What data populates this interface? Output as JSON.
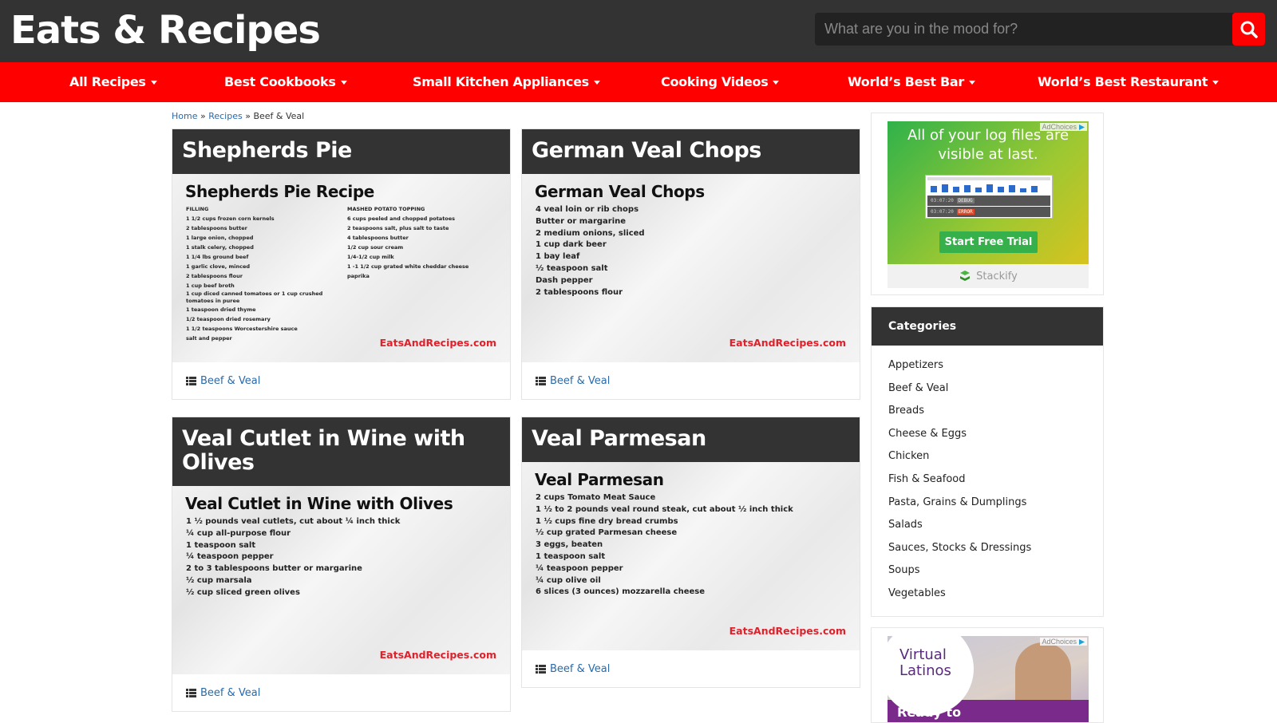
{
  "header": {
    "logo": "Eats & Recipes",
    "search_placeholder": "What are you in the mood for?"
  },
  "nav": {
    "items": [
      {
        "label": "All Recipes"
      },
      {
        "label": "Best Cookbooks"
      },
      {
        "label": "Small Kitchen Appliances"
      },
      {
        "label": "Cooking Videos"
      },
      {
        "label": "World’s Best Bar"
      },
      {
        "label": "World’s Best Restaurant"
      }
    ]
  },
  "breadcrumb": {
    "home": "Home",
    "sep": "»",
    "recipes": "Recipes",
    "current": "Beef & Veal"
  },
  "cards": [
    {
      "title": "Shepherds Pie",
      "image_title": "Shepherds Pie Recipe",
      "filling_heading": "FILLING",
      "filling": [
        "1 1/2 cups frozen corn kernels",
        "2 tablespoons butter",
        "1 large onion, chopped",
        "1 stalk celery, chopped",
        "1 1/4 lbs ground beef",
        "1 garlic clove, minced",
        "2 tablespoons flour",
        "1 cup beef broth",
        "1 cup diced canned tomatoes or 1 cup crushed",
        "tomatoes in puree",
        "1 teaspoon dried thyme",
        "1/2 teaspoon dried rosemary",
        "1 1/2 teaspoons Worcestershire sauce",
        "salt and pepper"
      ],
      "topping_heading": "MASHED POTATO TOPPING",
      "topping": [
        "6 cups peeled and chopped potatoes",
        "2 teaspoons salt, plus salt to taste",
        "4 tablespoons butter",
        "1/2 cup sour cream",
        "1/4-1/2 cup milk",
        "1 -1 1/2 cup grated white cheddar cheese",
        "paprika"
      ],
      "watermark": "EatsAndRecipes.com",
      "category": "Beef & Veal"
    },
    {
      "title": "German Veal Chops",
      "image_title": "German Veal Chops",
      "ingredients": [
        "4 veal loin or rib chops",
        "Butter or margarine",
        "2 medium onions, sliced",
        "1 cup dark beer",
        "1 bay leaf",
        "½ teaspoon salt",
        "Dash pepper",
        "2 tablespoons flour"
      ],
      "watermark": "EatsAndRecipes.com",
      "category": "Beef & Veal"
    },
    {
      "title": "Veal Cutlet in Wine with Olives",
      "image_title": "Veal Cutlet in Wine with Olives",
      "ingredients": [
        "1 ½ pounds veal cutlets, cut about ¼ inch thick",
        "¼ cup all-purpose flour",
        "1 teaspoon salt",
        "¼ teaspoon pepper",
        "2 to 3 tablespoons butter or margarine",
        "½ cup marsala",
        "½ cup sliced green olives"
      ],
      "watermark": "EatsAndRecipes.com",
      "category": "Beef & Veal"
    },
    {
      "title": "Veal Parmesan",
      "image_title": "Veal Parmesan",
      "ingredients": [
        "2 cups Tomato Meat Sauce",
        "1 ½ to 2 pounds veal round steak, cut about ½ inch thick",
        "1 ½ cups fine dry bread crumbs",
        "½ cup grated Parmesan cheese",
        "3 eggs, beaten",
        "1 teaspoon salt",
        "¼ teaspoon pepper",
        "¼ cup olive oil",
        "6 slices (3 ounces) mozzarella cheese"
      ],
      "watermark": "EatsAndRecipes.com",
      "category": "Beef & Veal"
    }
  ],
  "ad1": {
    "adchoices": "AdChoices",
    "headline": "All of your log files are visible at last.",
    "log_time_1": "03:07:20",
    "log_level_1": "DEBUG",
    "log_time_2": "03:07:20",
    "log_level_2": "ERROR",
    "cta": "Start Free Trial",
    "brand": "Stackify"
  },
  "categories": {
    "heading": "Categories",
    "items": [
      "Appetizers",
      "Beef & Veal",
      "Breads",
      "Cheese & Eggs",
      "Chicken",
      "Fish & Seafood",
      "Pasta, Grains & Dumplings",
      "Salads",
      "Sauces, Stocks & Dressings",
      "Soups",
      "Vegetables"
    ]
  },
  "ad2": {
    "adchoices": "AdChoices",
    "brand_line1": "Virtual",
    "brand_line2": "Latinos",
    "tagline": "Ready to"
  },
  "colors": {
    "brand_red": "#ff0000",
    "header_dark": "#333333",
    "link_blue": "#2a6aa8",
    "watermark_red": "#e0202a"
  }
}
